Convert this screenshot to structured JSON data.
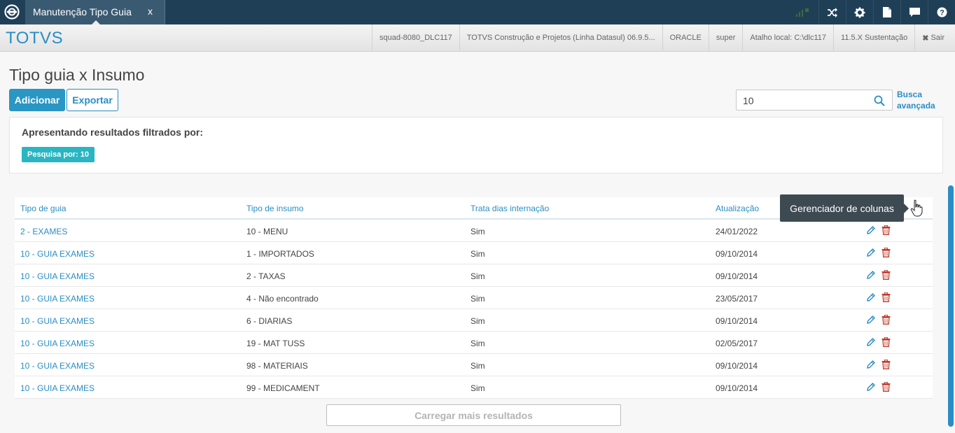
{
  "topbar": {
    "tab_label": "Manutenção Tipo Guia",
    "tab_close": "x",
    "icons": [
      "shuffle-icon",
      "gear-icon",
      "document-icon",
      "chat-icon",
      "help-icon"
    ]
  },
  "brandbar": {
    "brand": "TOTVS",
    "items": [
      "squad-8080_DLC117",
      "TOTVS Construção e Projetos (Linha Datasul) 06.9.5...",
      "ORACLE",
      "super",
      "Atalho local: C:\\dlc117",
      "11.5.X Sustentação"
    ],
    "logout": "Sair"
  },
  "page": {
    "title": "Tipo guia x Insumo",
    "add_label": "Adicionar",
    "export_label": "Exportar",
    "search_value": "10",
    "advanced_search_line1": "Busca",
    "advanced_search_line2": "avançada"
  },
  "filter": {
    "title": "Apresentando resultados filtrados por:",
    "chip": "Pesquisa por: 10"
  },
  "table": {
    "headers": [
      "Tipo de guia",
      "Tipo de insumo",
      "Trata dias internação",
      "Atualização"
    ],
    "rows": [
      [
        "2 - EXAMES",
        "10 - MENU",
        "Sim",
        "24/01/2022"
      ],
      [
        "10 - GUIA EXAMES",
        "1 - IMPORTADOS",
        "Sim",
        "09/10/2014"
      ],
      [
        "10 - GUIA EXAMES",
        "2 - TAXAS",
        "Sim",
        "09/10/2014"
      ],
      [
        "10 - GUIA EXAMES",
        "4 - Não encontrado",
        "Sim",
        "23/05/2017"
      ],
      [
        "10 - GUIA EXAMES",
        "6 - DIARIAS",
        "Sim",
        "09/10/2014"
      ],
      [
        "10 - GUIA EXAMES",
        "19 - MAT TUSS",
        "Sim",
        "02/05/2017"
      ],
      [
        "10 - GUIA EXAMES",
        "98 - MATERIAIS",
        "Sim",
        "09/10/2014"
      ],
      [
        "10 - GUIA EXAMES",
        "99 - MEDICAMENT",
        "Sim",
        "09/10/2014"
      ]
    ]
  },
  "load_more": "Carregar mais resultados",
  "tooltip": "Gerenciador de colunas",
  "colors": {
    "topbar": "#1f3f57",
    "accent": "#2a8ec5",
    "chip": "#29b6c2",
    "delete": "#c0392b"
  }
}
